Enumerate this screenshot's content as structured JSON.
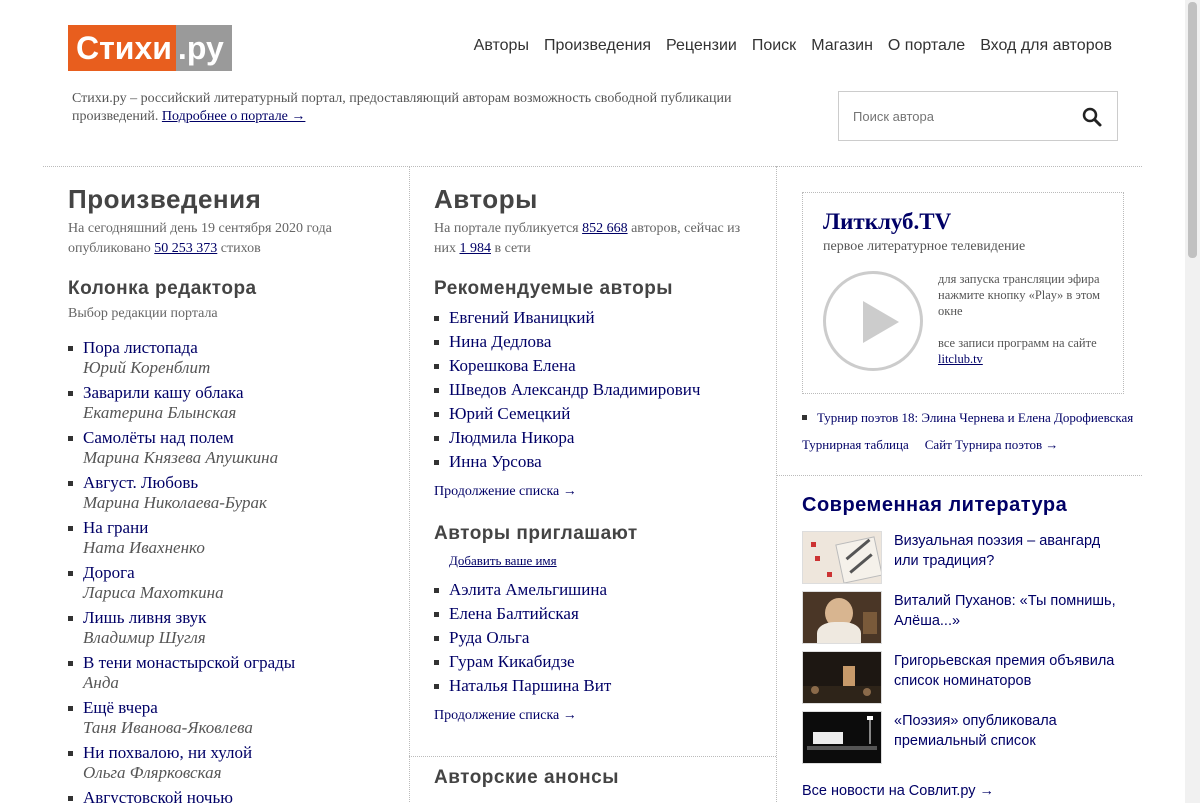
{
  "logo": {
    "part1": "Стихи",
    "part2": ".ру"
  },
  "nav": [
    "Авторы",
    "Произведения",
    "Рецензии",
    "Поиск",
    "Магазин",
    "О портале",
    "Вход для авторов"
  ],
  "intro": {
    "text": "Стихи.ру – российский литературный портал, предоставляющий авторам возможность свободной публикации произведений.",
    "link": "Подробнее о портале →"
  },
  "search": {
    "placeholder": "Поиск автора"
  },
  "works": {
    "title": "Произведения",
    "stat_prefix": "На сегодняшний день 19 сентября 2020 года опубликовано",
    "stat_count": "50 253 373",
    "stat_suffix": "стихов",
    "editor_title": "Колонка редактора",
    "editor_note": "Выбор редакции портала",
    "items": [
      {
        "title": "Пора листопада",
        "author": "Юрий Коренблит"
      },
      {
        "title": "Заварили кашу облака",
        "author": "Екатерина Блынская"
      },
      {
        "title": "Самолёты над полем",
        "author": "Марина Князева Апушкина"
      },
      {
        "title": "Август. Любовь",
        "author": "Марина Николаева-Бурак"
      },
      {
        "title": "На грани",
        "author": "Ната Ивахненко"
      },
      {
        "title": "Дорога",
        "author": "Лариса Махоткина"
      },
      {
        "title": "Лишь ливня звук",
        "author": "Владимир Шугля"
      },
      {
        "title": "В тени монастырской ограды",
        "author": "Анда"
      },
      {
        "title": "Ещё вчера",
        "author": "Таня Иванова-Яковлева"
      },
      {
        "title": "Ни похвалою, ни хулой",
        "author": "Ольга Флярковская"
      },
      {
        "title": "Августовской ночью",
        "author": ""
      }
    ]
  },
  "authors": {
    "title": "Авторы",
    "stat_prefix": "На портале публикуется",
    "stat_count": "852 668",
    "stat_mid": "авторов, сейчас из них",
    "online_count": "1 984",
    "stat_suffix": "в сети",
    "recommended_title": "Рекомендуемые авторы",
    "recommended": [
      "Евгений Иваницкий",
      "Нина Дедлова",
      "Корешкова Елена",
      "Шведов Александр Владимирович",
      "Юрий Семецкий",
      "Людмила Никора",
      "Инна Урсова"
    ],
    "more1": "Продолжение списка →",
    "invite_title": "Авторы приглашают",
    "add_name": "Добавить ваше имя",
    "invite": [
      "Аэлита Амельгишина",
      "Елена Балтийская",
      "Руда Ольга",
      "Гурам Кикабидзе",
      "Наталья Паршина Вит"
    ],
    "more2": "Продолжение списка →",
    "anons_title": "Авторские анонсы"
  },
  "litclub": {
    "title": "Литклуб.TV",
    "subtitle": "первое литературное телевидение",
    "desc": "для запуска трансляции эфира нажмите кнопку «Play» в этом окне",
    "desc2": "все записи программ на сайте",
    "link": "litclub.tv"
  },
  "tournament": {
    "item": "Турнир поэтов 18: Элина Чернева и Елена Дорофиевская",
    "table": "Турнирная таблица",
    "site": "Сайт Турнира поэтов →"
  },
  "modern": {
    "title": "Современная литература",
    "news": [
      {
        "text": "Визуальная поэзия – авангард или традиция?"
      },
      {
        "text": "Виталий Пуханов: «Ты помнишь, Алёша...»"
      },
      {
        "text": "Григорьевская премия объявила список номинаторов"
      },
      {
        "text": "«Поэзия» опубликовала премиальный список"
      }
    ],
    "all": "Все новости на Совлит.ру →"
  },
  "colors": {
    "accent": "#e85e1e",
    "link": "#000066",
    "logo_gray": "#9a9a9a"
  }
}
